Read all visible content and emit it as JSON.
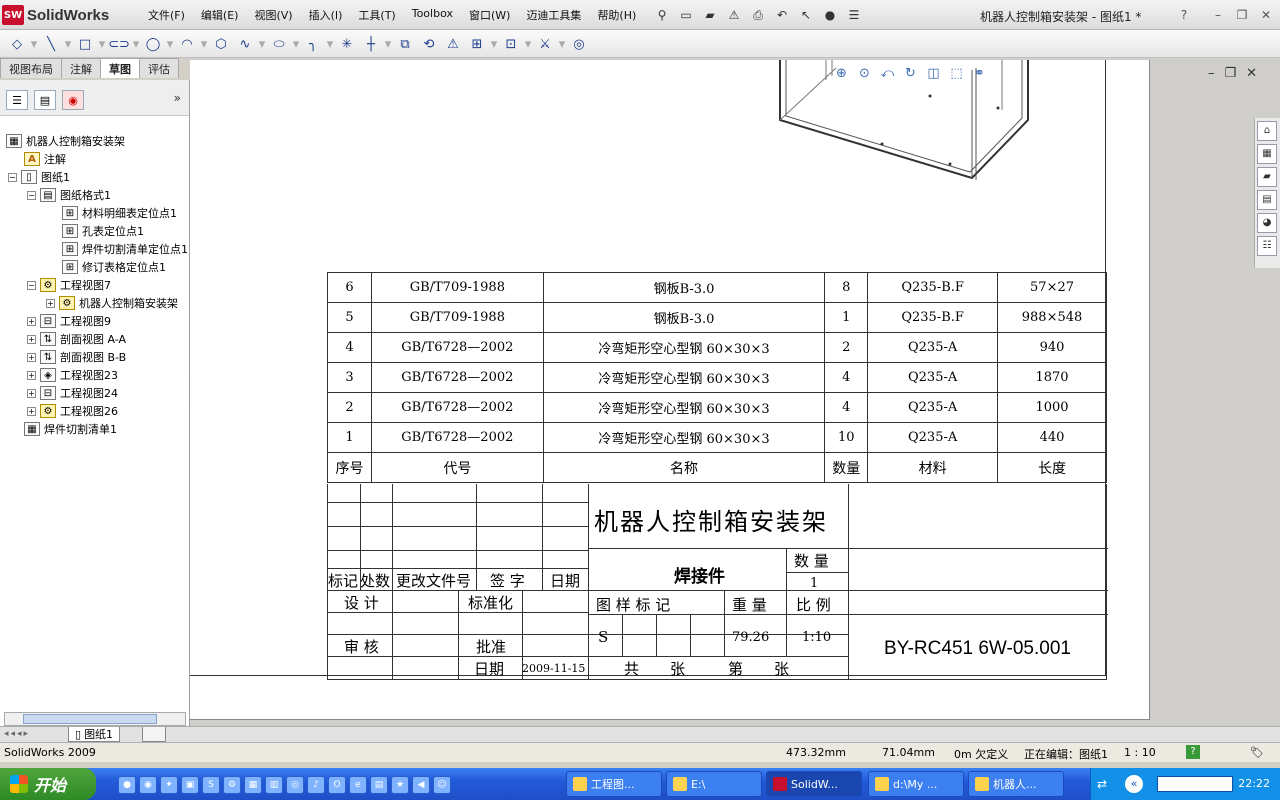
{
  "app": {
    "logo": "SolidWorks",
    "logo_mark": "SW",
    "title": "机器人控制箱安装架 - 图纸1 *",
    "menus": [
      "文件(F)",
      "编辑(E)",
      "视图(V)",
      "插入(I)",
      "工具(T)",
      "Toolbox",
      "窗口(W)",
      "迈迪工具集",
      "帮助(H)"
    ],
    "help": "?"
  },
  "cm_tabs": [
    "视图布局",
    "注解",
    "草图",
    "评估"
  ],
  "cm_active": "草图",
  "tree": {
    "expand_label": "»",
    "root": "机器人控制箱安装架",
    "items": [
      {
        "label": "注解",
        "icon": "annotation-icon"
      },
      {
        "label": "图纸1",
        "icon": "sheet-icon"
      },
      {
        "label": "图纸格式1",
        "icon": "sheet-format-icon"
      },
      {
        "label": "材料明细表定位点1",
        "icon": "anchor-icon"
      },
      {
        "label": "孔表定位点1",
        "icon": "anchor-icon"
      },
      {
        "label": "焊件切割清单定位点1",
        "icon": "anchor-icon"
      },
      {
        "label": "修订表格定位点1",
        "icon": "anchor-icon"
      },
      {
        "label": "工程视图7",
        "icon": "drawing-view-icon"
      },
      {
        "label": "机器人控制箱安装架",
        "icon": "part-icon"
      },
      {
        "label": "工程视图9",
        "icon": "drawing-view-icon"
      },
      {
        "label": "剖面视图 A-A",
        "icon": "section-view-icon"
      },
      {
        "label": "剖面视图 B-B",
        "icon": "section-view-icon"
      },
      {
        "label": "工程视图23",
        "icon": "drawing-view-icon"
      },
      {
        "label": "工程视图24",
        "icon": "drawing-view-icon"
      },
      {
        "label": "工程视图26",
        "icon": "drawing-view-icon"
      },
      {
        "label": "焊件切割清单1",
        "icon": "cut-list-icon"
      }
    ]
  },
  "bom": {
    "rows": [
      {
        "no": "6",
        "code": "GB/T709-1988",
        "name": "钢板B-3.0",
        "qty": "8",
        "material": "Q235-B.F",
        "length": "57×27"
      },
      {
        "no": "5",
        "code": "GB/T709-1988",
        "name": "钢板B-3.0",
        "qty": "1",
        "material": "Q235-B.F",
        "length": "988×548"
      },
      {
        "no": "4",
        "code": "GB/T6728—2002",
        "name": "冷弯矩形空心型钢 60×30×3",
        "qty": "2",
        "material": "Q235-A",
        "length": "940"
      },
      {
        "no": "3",
        "code": "GB/T6728—2002",
        "name": "冷弯矩形空心型钢 60×30×3",
        "qty": "4",
        "material": "Q235-A",
        "length": "1870"
      },
      {
        "no": "2",
        "code": "GB/T6728—2002",
        "name": "冷弯矩形空心型钢 60×30×3",
        "qty": "4",
        "material": "Q235-A",
        "length": "1000"
      },
      {
        "no": "1",
        "code": "GB/T6728—2002",
        "name": "冷弯矩形空心型钢 60×30×3",
        "qty": "10",
        "material": "Q235-A",
        "length": "440"
      }
    ],
    "header": {
      "no": "序号",
      "code": "代号",
      "name": "名称",
      "qty": "数量",
      "material": "材料",
      "length": "长度"
    }
  },
  "title_block": {
    "drawing_title": "机器人控制箱安装架",
    "weldment": "焊接件",
    "qty_label": "数 量",
    "qty_value": "1",
    "rev_mark": "标记",
    "rev_count": "处数",
    "rev_doc": "更改文件号",
    "rev_sign": "签 字",
    "rev_date": "日期",
    "design": "设 计",
    "standard": "标准化",
    "check": "审 核",
    "approve": "批准",
    "date_label": "日期",
    "date_value": "2009-11-15",
    "stage_mark": "图 样 标 记",
    "weight_label": "重 量",
    "scale_label": "比 例",
    "stage_value": "S",
    "weight_value": "79.26",
    "scale_value": "1:10",
    "total_sheets": "共",
    "sheet_unit1": "张",
    "sheet_no": "第",
    "sheet_unit2": "张",
    "drawing_no": "BY-RC451 6W-05.001"
  },
  "sheet_tab": "图纸1",
  "status": {
    "app": "SolidWorks 2009",
    "x": "473.32mm",
    "y": "71.04mm",
    "def": "0m 欠定义",
    "editing": "正在编辑：图纸1",
    "scale": "1 : 10",
    "help": "?"
  },
  "taskbar": {
    "start": "开始",
    "buttons": [
      "工程图...",
      "E:\\",
      "SolidW...",
      "d:\\My ...",
      "机器人..."
    ],
    "active_index": 2,
    "clock": "22:22"
  }
}
